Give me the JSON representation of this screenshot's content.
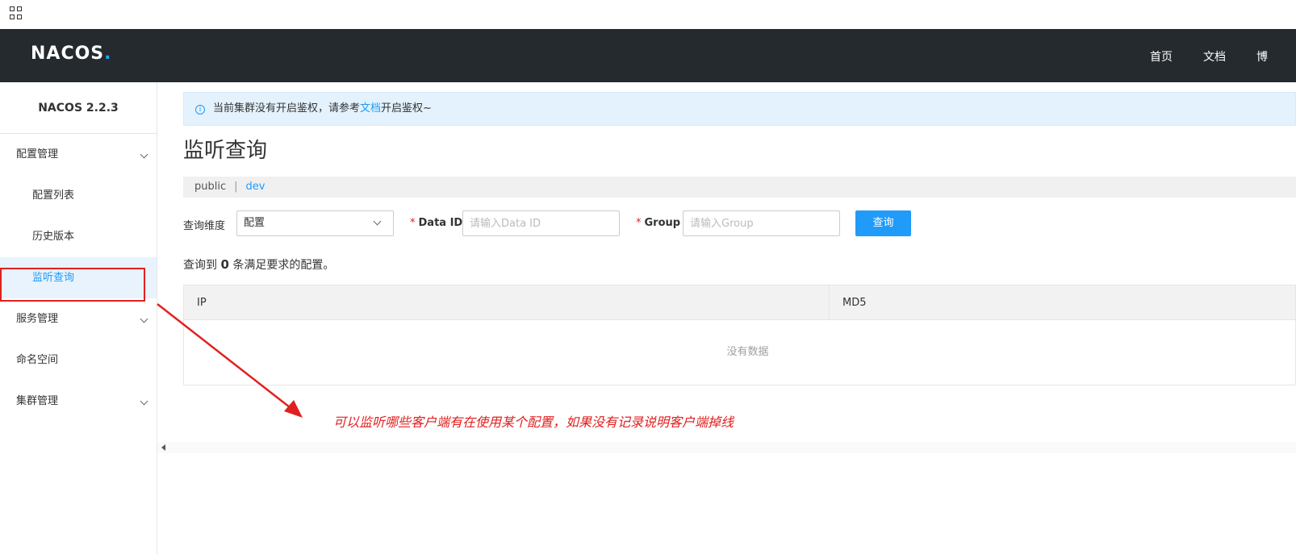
{
  "header": {
    "logo_text": "NACOS",
    "nav_home": "首页",
    "nav_docs": "文档",
    "nav_more": "博"
  },
  "sidebar": {
    "version": "NACOS 2.2.3",
    "items": [
      {
        "label": "配置管理"
      },
      {
        "label": "配置列表"
      },
      {
        "label": "历史版本"
      },
      {
        "label": "监听查询"
      },
      {
        "label": "服务管理"
      },
      {
        "label": "命名空间"
      },
      {
        "label": "集群管理"
      }
    ]
  },
  "notice": {
    "text_before": "当前集群没有开启鉴权，请参考",
    "link": "文档",
    "text_after": "开启鉴权~"
  },
  "page_title": "监听查询",
  "namespaces": {
    "public": "public",
    "separator": "|",
    "dev": "dev"
  },
  "form": {
    "dimension_label": "查询维度",
    "dimension_value": "配置",
    "required_mark": "*",
    "dataid_label": "Data ID",
    "dataid_placeholder": "请输入Data ID",
    "group_label": "Group",
    "group_placeholder": "请输入Group",
    "search_button": "查询"
  },
  "result": {
    "prefix": "查询到",
    "count": "0",
    "suffix": "条满足要求的配置。"
  },
  "table": {
    "columns": [
      "IP",
      "MD5"
    ],
    "empty_text": "没有数据"
  },
  "annotation": {
    "text": "可以监听哪些客户端有在使用某个配置，如果没有记录说明客户端掉线"
  },
  "colors": {
    "header_bg": "#252a2f",
    "accent": "#209bfa",
    "annotation_red": "#e02020"
  }
}
